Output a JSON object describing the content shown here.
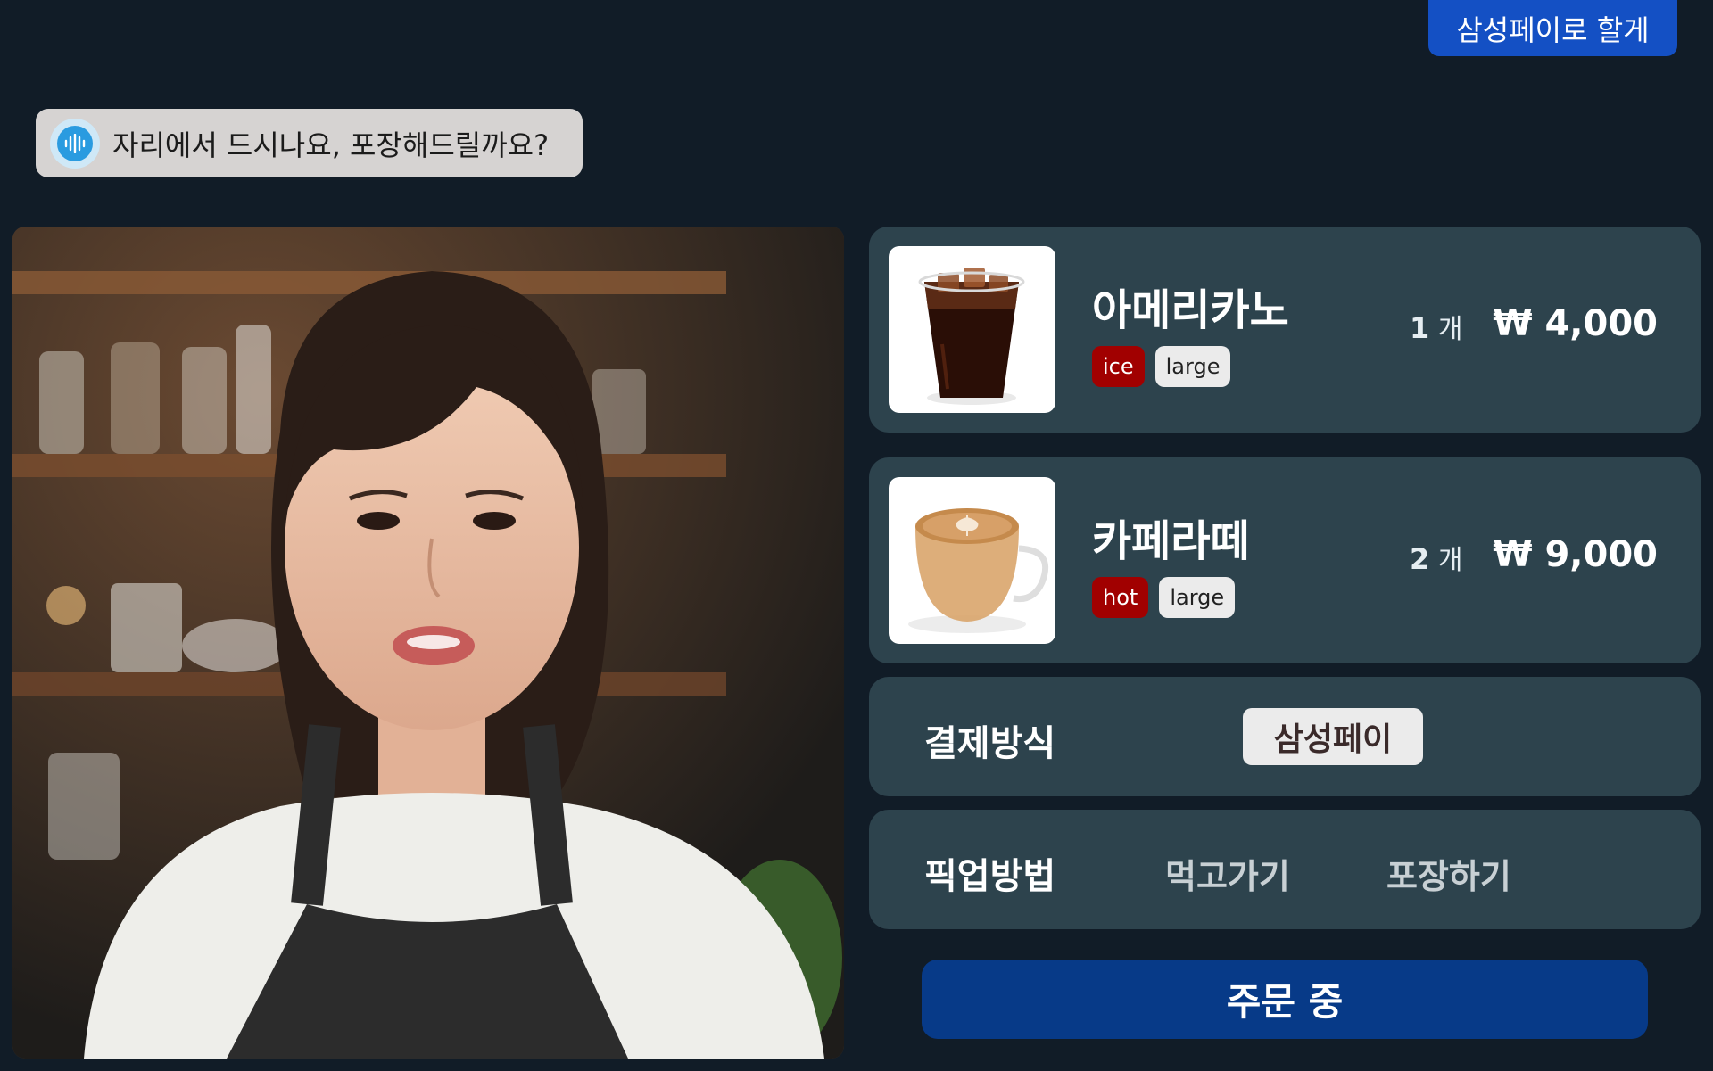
{
  "user_message": "삼성페이로 할게",
  "assistant_message": "자리에서 드시나요, 포장해드릴까요?",
  "icons": {
    "voice": "voice-wave-icon"
  },
  "order_items": [
    {
      "name": "아메리카노",
      "temp": "ice",
      "size": "large",
      "qty": "1",
      "qty_unit": "개",
      "price": "₩ 4,000"
    },
    {
      "name": "카페라떼",
      "temp": "hot",
      "size": "large",
      "qty": "2",
      "qty_unit": "개",
      "price": "₩ 9,000"
    }
  ],
  "payment": {
    "label": "결제방식",
    "selected": "삼성페이"
  },
  "pickup": {
    "label": "픽업방법",
    "options": [
      "먹고가기",
      "포장하기"
    ]
  },
  "order_button": "주문 중",
  "colors": {
    "background": "#111c27",
    "card": "#2d434d",
    "user_bubble": "#1450c4",
    "assistant_bubble": "#d6d3d2",
    "tag_temp": "#a10000",
    "tag_size": "#ebebeb",
    "order_button": "#073a88"
  }
}
